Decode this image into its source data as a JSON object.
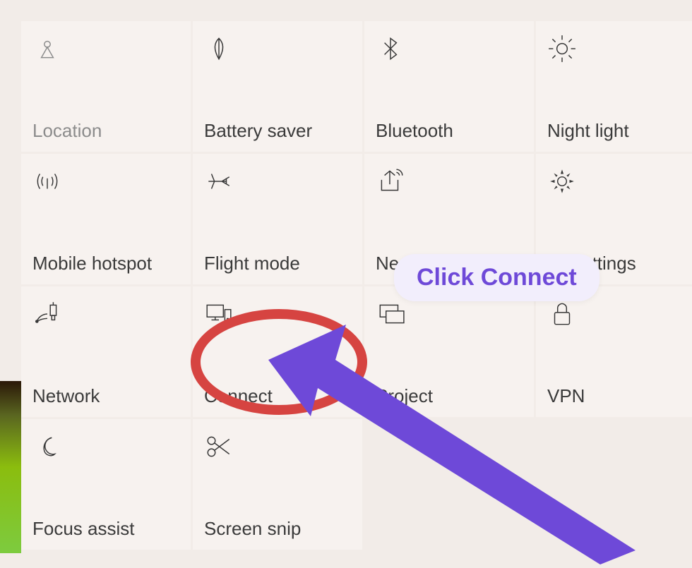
{
  "annotation": {
    "callout": "Click Connect"
  },
  "tiles": {
    "location": {
      "label": "Location"
    },
    "battery_saver": {
      "label": "Battery saver"
    },
    "bluetooth": {
      "label": "Bluetooth"
    },
    "night_light": {
      "label": "Night light"
    },
    "mobile_hotspot": {
      "label": "Mobile hotspot"
    },
    "flight_mode": {
      "label": "Flight mode"
    },
    "nearby_sharing": {
      "label": "Nearby sharing"
    },
    "all_settings": {
      "label": "All settings"
    },
    "network": {
      "label": "Network"
    },
    "connect": {
      "label": "Connect"
    },
    "project": {
      "label": "Project"
    },
    "vpn": {
      "label": "VPN"
    },
    "focus_assist": {
      "label": "Focus assist"
    },
    "screen_snip": {
      "label": "Screen snip"
    }
  }
}
